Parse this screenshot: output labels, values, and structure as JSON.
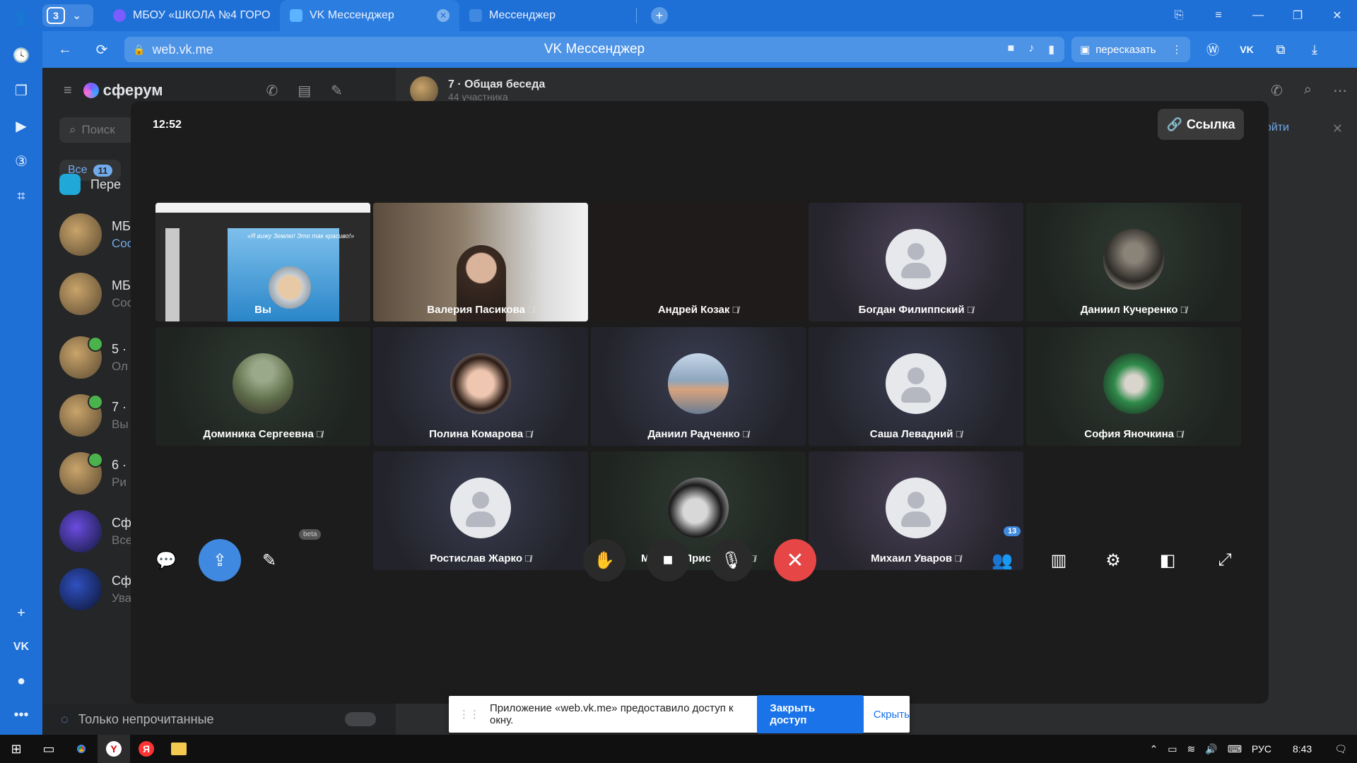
{
  "browser": {
    "tab_count": "3",
    "tabs": [
      {
        "title": "МБОУ «ШКОЛА №4 ГОРО",
        "favicon_color": "#7a5cff"
      },
      {
        "title": "VK Мессенджер",
        "favicon_color": "#5cb3ff"
      },
      {
        "title": "Мессенджер",
        "favicon_color": "#3f8ae0"
      }
    ],
    "url": "web.vk.me",
    "page_title": "VK Мессенджер",
    "retell_label": "пересказать"
  },
  "messenger": {
    "app_name": "сферум",
    "search_placeholder": "Поиск",
    "filter_label": "Все",
    "filter_count": "11",
    "pinned_label": "Пере",
    "chats": [
      {
        "name": "МБ",
        "sub": "Соо"
      },
      {
        "name": "МБ",
        "sub": "Соо"
      },
      {
        "name": "5 ·",
        "sub": "Ол"
      },
      {
        "name": "7 ·",
        "sub": "Вы"
      },
      {
        "name": "6 ·",
        "sub": "Ри"
      },
      {
        "name": "Сф",
        "sub": "Все"
      },
      {
        "name": "Сф",
        "sub": "Ува"
      }
    ],
    "unread_only_label": "Только непрочитанные",
    "conversation_title": "7 · Общая беседа",
    "conversation_sub": "44 участника",
    "login_label": "Войти"
  },
  "call": {
    "time": "12:52",
    "link_label": "Ссылка",
    "participants": [
      {
        "name": "Вы",
        "kind": "screen",
        "muted": false
      },
      {
        "name": "Валерия Пасикова",
        "kind": "camera",
        "muted": true
      },
      {
        "name": "Андрей Козак",
        "kind": "dark",
        "muted": true
      },
      {
        "name": "Богдан Филиппский",
        "kind": "placeholder",
        "muted": true
      },
      {
        "name": "Даниил Кучеренко",
        "kind": "photo",
        "muted": true
      },
      {
        "name": "Доминика Сергеевна",
        "kind": "photo",
        "muted": true
      },
      {
        "name": "Полина Комарова",
        "kind": "photo",
        "muted": true
      },
      {
        "name": "Даниил Радченко",
        "kind": "photo",
        "muted": true
      },
      {
        "name": "Саша Левадний",
        "kind": "placeholder",
        "muted": true
      },
      {
        "name": "София Яночкина",
        "kind": "photo",
        "muted": true
      },
      {
        "name": "Ростислав Жарко",
        "kind": "placeholder",
        "muted": true
      },
      {
        "name": "Михаил Присяжный",
        "kind": "photo",
        "muted": true
      },
      {
        "name": "Михаил Уваров",
        "kind": "placeholder",
        "muted": true
      }
    ],
    "screen_caption": "«Я вижу Землю! Это так красиво!»",
    "beta_label": "beta",
    "participants_count": "13"
  },
  "notice": {
    "text": "Приложение «web.vk.me» предоставило доступ к окну.",
    "close_access_label": "Закрыть доступ",
    "hide_label": "Скрыть"
  },
  "taskbar": {
    "lang": "РУС",
    "clock": "8:43"
  },
  "colors": {
    "browser_blue": "#1e6fd6",
    "call_bg": "#1c1c1c",
    "accent": "#3f8ae0",
    "hangup": "#e64646"
  }
}
